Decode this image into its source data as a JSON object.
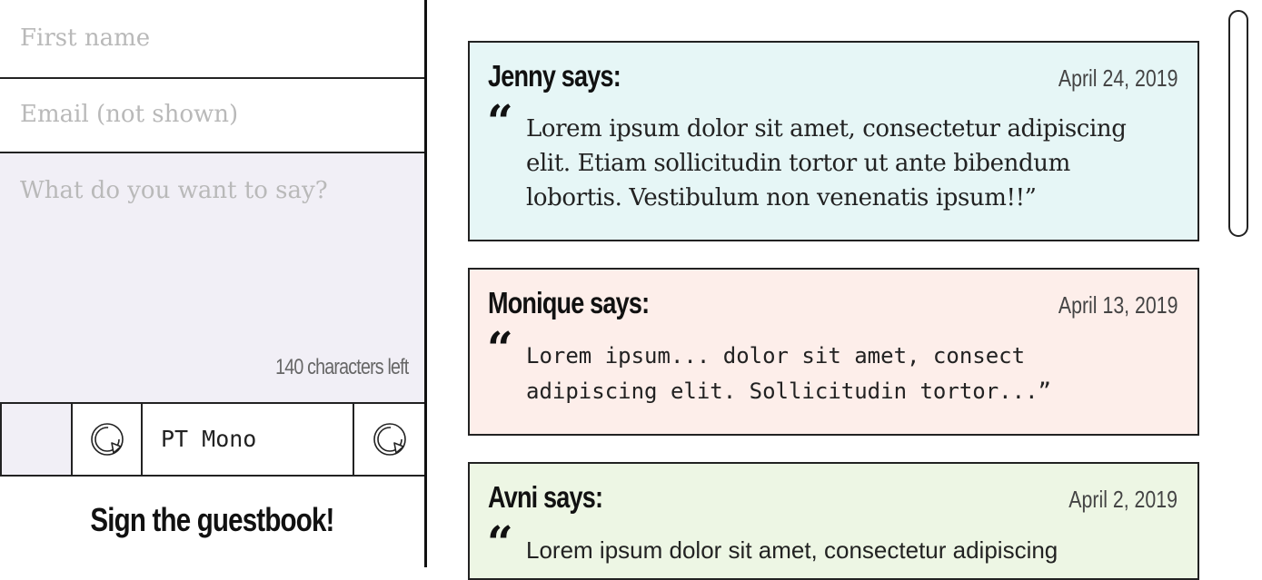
{
  "form": {
    "first_name_placeholder": "First name",
    "email_placeholder": "Email (not shown)",
    "message_placeholder": "What do you want to say?",
    "chars_left": "140 characters left",
    "swatch_color": "#f1eff6",
    "font_name": "PT Mono",
    "refresh_icon": "refresh-icon",
    "submit_label": "Sign the guestbook!"
  },
  "entries": [
    {
      "author": "Jenny says:",
      "date": "April 24, 2019",
      "quote_mark": "“",
      "text": "Lorem ipsum dolor sit amet, consectetur adipiscing elit. Etiam sollicitudin tortor ut ante bibendum lobortis. Vestibulum non venenatis ipsum!!”",
      "bg": "#e6f6f6"
    },
    {
      "author": "Monique says:",
      "date": "April 13, 2019",
      "quote_mark": "“",
      "text": "Lorem ipsum... dolor sit amet, consect adipiscing elit. Sollicitudin tortor...”",
      "bg": "#fdeeea"
    },
    {
      "author": "Avni says:",
      "date": "April 2, 2019",
      "quote_mark": "“",
      "text": "Lorem ipsum dolor sit amet, consectetur adipiscing",
      "bg": "#edf6e4"
    }
  ]
}
